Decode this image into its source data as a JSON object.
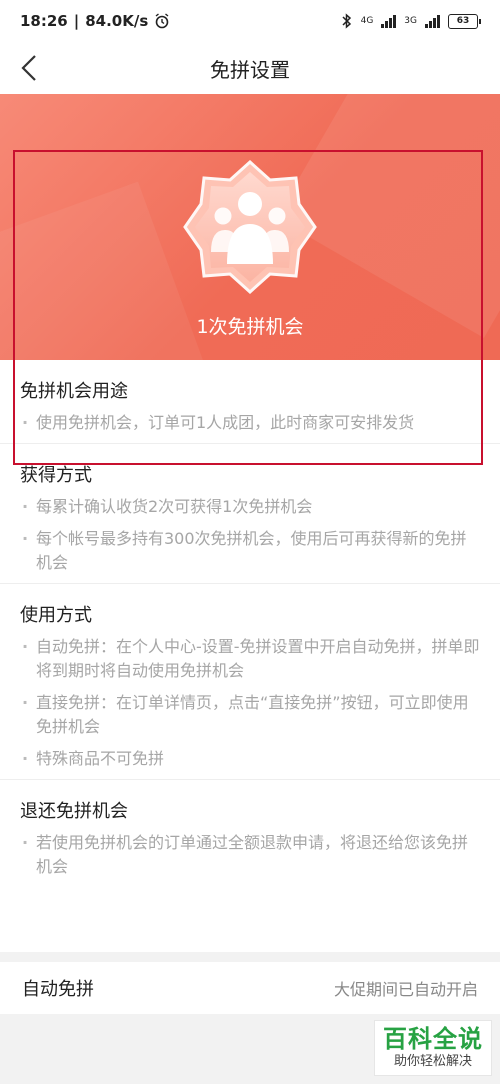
{
  "status_bar": {
    "time": "18:26",
    "network_speed": "84.0K/s",
    "sim1_label": "4G",
    "sim2_label": "3G",
    "battery": "63"
  },
  "nav": {
    "title": "免拼设置"
  },
  "banner": {
    "text": "1次免拼机会"
  },
  "sections": [
    {
      "title": "免拼机会用途",
      "bullets": [
        "使用免拼机会，订单可1人成团，此时商家可安排发货"
      ]
    },
    {
      "title": "获得方式",
      "bullets": [
        "每累计确认收货2次可获得1次免拼机会",
        "每个帐号最多持有300次免拼机会，使用后可再获得新的免拼机会"
      ]
    },
    {
      "title": "使用方式",
      "bullets": [
        "自动免拼：在个人中心-设置-免拼设置中开启自动免拼，拼单即将到期时将自动使用免拼机会",
        "直接免拼：在订单详情页，点击“直接免拼”按钮，可立即使用免拼机会",
        "特殊商品不可免拼"
      ]
    },
    {
      "title": "退还免拼机会",
      "bullets": [
        "若使用免拼机会的订单通过全额退款申请，将退还给您该免拼机会"
      ]
    }
  ],
  "auto_row": {
    "label": "自动免拼",
    "value": "大促期间已自动开启"
  },
  "watermark": {
    "title": "百科全说",
    "subtitle": "助你轻松解决"
  },
  "colors": {
    "banner": "#f06b56",
    "highlight_border": "#c8102e",
    "watermark_green": "#27a243"
  }
}
